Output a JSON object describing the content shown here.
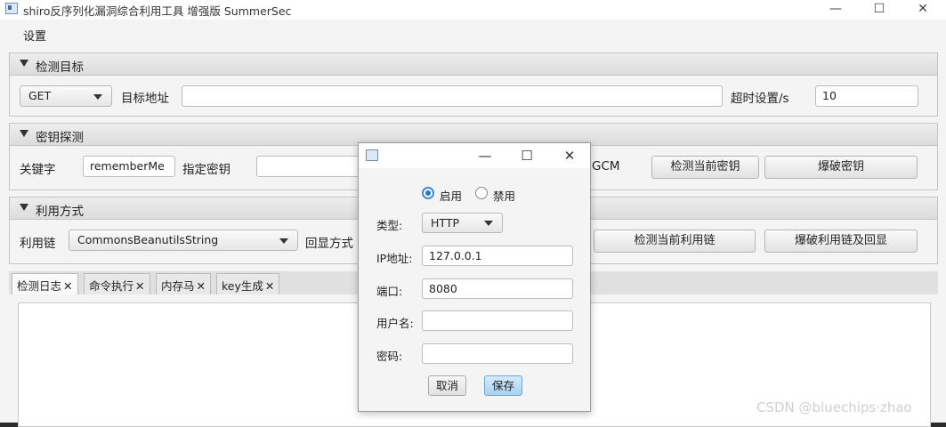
{
  "window": {
    "title": "shiro反序列化漏洞综合利用工具 增强版 SummerSec",
    "controls": {
      "minimize": "—",
      "maximize": "☐",
      "close": "✕"
    }
  },
  "menu": {
    "settings": "设置"
  },
  "target": {
    "header": "检测目标",
    "method": "GET",
    "url_label": "目标地址",
    "url_value": "",
    "timeout_label": "超时设置/s",
    "timeout_value": "10"
  },
  "key": {
    "header": "密钥探测",
    "keyword_label": "关键字",
    "keyword_value": "rememberMe",
    "key_label": "指定密钥",
    "key_value": "",
    "gcm_label": "GCM",
    "detect_button": "检测当前密钥",
    "bruteforce_button": "爆破密钥"
  },
  "exploit": {
    "header": "利用方式",
    "chain_label": "利用链",
    "chain_value": "CommonsBeanutilsString",
    "echo_label": "回显方式",
    "detect_chain_button": "检测当前利用链",
    "bruteforce_chain_button": "爆破利用链及回显"
  },
  "tabs": [
    {
      "label": "检测日志",
      "close": "✕"
    },
    {
      "label": "命令执行",
      "close": "✕"
    },
    {
      "label": "内存马",
      "close": "✕"
    },
    {
      "label": "key生成",
      "close": "✕"
    }
  ],
  "proxy_dialog": {
    "controls": {
      "minimize": "—",
      "maximize": "☐",
      "close": "✕"
    },
    "enable_label": "启用",
    "disable_label": "禁用",
    "type_label": "类型:",
    "type_value": "HTTP",
    "ip_label": "IP地址:",
    "ip_value": "127.0.0.1",
    "port_label": "端口:",
    "port_value": "8080",
    "user_label": "用户名:",
    "user_value": "",
    "password_label": "密码:",
    "password_value": "",
    "cancel_button": "取消",
    "save_button": "保存"
  },
  "watermark": "CSDN @bluechips·zhao"
}
